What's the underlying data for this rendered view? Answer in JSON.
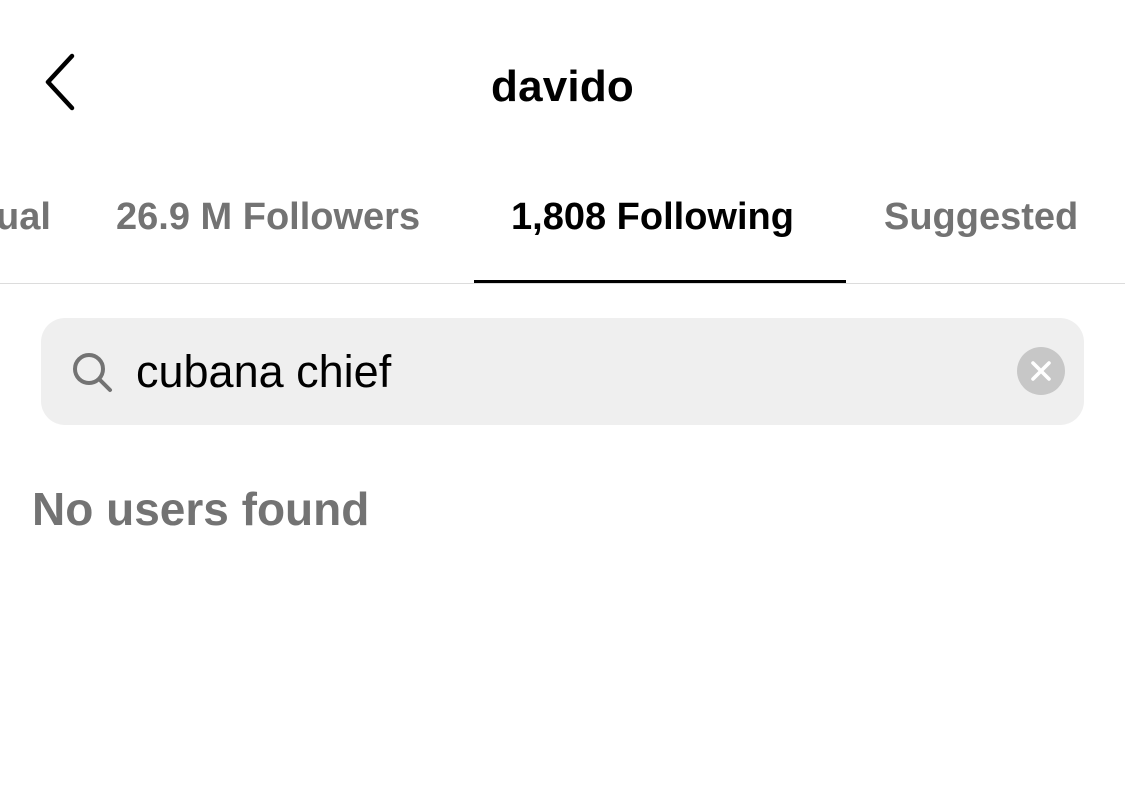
{
  "header": {
    "title": "davido",
    "back_icon": "chevron-left-icon"
  },
  "tabs": [
    {
      "label": "ual",
      "active": false
    },
    {
      "label": "26.9 M Followers",
      "active": false
    },
    {
      "label": "1,808 Following",
      "active": true
    },
    {
      "label": "Suggested",
      "active": false
    }
  ],
  "search": {
    "icon": "search-icon",
    "value": "cubana chief",
    "clear_icon": "clear-icon"
  },
  "results": {
    "empty_message": "No users found"
  },
  "colors": {
    "text_primary": "#000000",
    "text_secondary": "#737373",
    "search_background": "#efefef",
    "clear_button": "#c7c7c7",
    "divider": "#dcdcdc"
  }
}
